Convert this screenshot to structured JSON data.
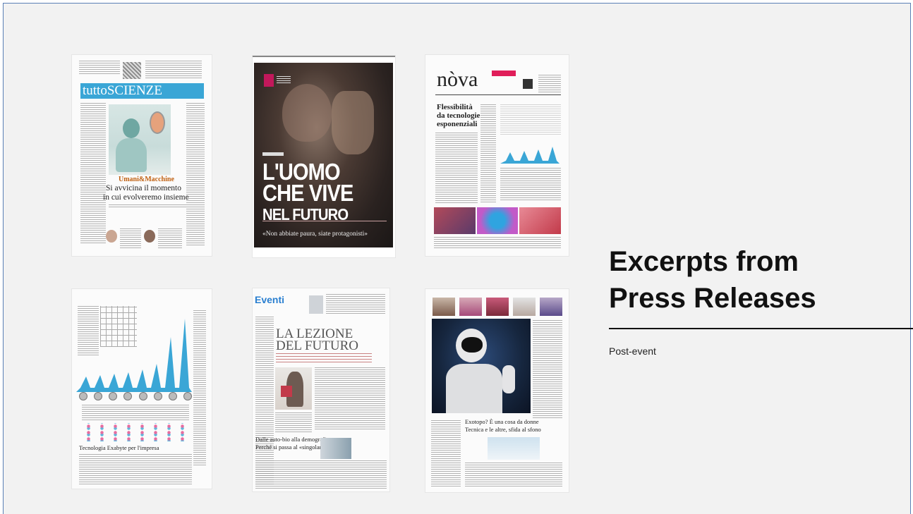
{
  "slide": {
    "title_line1": "Excerpts from",
    "title_line2": "Press Releases",
    "subtitle": "Post-event"
  },
  "clippings": {
    "p1": {
      "banner": "tuttoSCIENZE",
      "headline_tag": "Umani&Macchine",
      "headline1": "Si avvicina il momento",
      "headline2": "in cui evolveremo insieme"
    },
    "p2": {
      "title1": "L'UOMO",
      "title2": "CHE VIVE",
      "title3": "NEL FUTURO",
      "quote": "«Non abbiate paura, siate protagonisti»"
    },
    "p3": {
      "masthead": "nòva",
      "headline1": "Flessibilità",
      "headline2": "da tecnologie",
      "headline3": "esponenziali"
    },
    "p4": {
      "headline": "Tecnologia Exabyte per l'impresa"
    },
    "p5": {
      "section": "Eventi",
      "headline1": "LA LEZIONE",
      "headline2": "DEL FUTURO",
      "headline3": "Dalle auto-bio alla demografia",
      "headline4": "Perché si passa al «singolare»"
    },
    "p6": {
      "headline1": "Exotopo? È una cosa da donne",
      "headline2": "Tecnica e le altre, sfida al sfono"
    }
  },
  "colors": {
    "accent_blue": "#3aa6d6",
    "accent_pink": "#e01e5a",
    "frame": "#5a7fb5"
  }
}
